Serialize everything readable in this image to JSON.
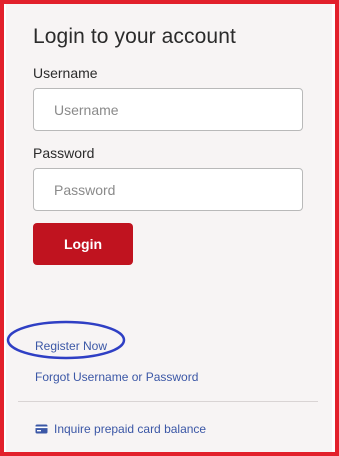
{
  "form": {
    "title": "Login to your account",
    "username_label": "Username",
    "username_placeholder": "Username",
    "username_value": "",
    "password_label": "Password",
    "password_placeholder": "Password",
    "password_value": "",
    "login_button_label": "Login"
  },
  "links": {
    "register": "Register Now",
    "forgot": "Forgot Username or Password",
    "inquire": "Inquire prepaid card balance",
    "inquire_icon": "credit-card-icon"
  },
  "colors": {
    "frame_border": "#e2202b",
    "login_button": "#c0131f",
    "link": "#3b57a6",
    "annotation_oval": "#2f3fc4",
    "panel_background": "#f7f4f4"
  }
}
